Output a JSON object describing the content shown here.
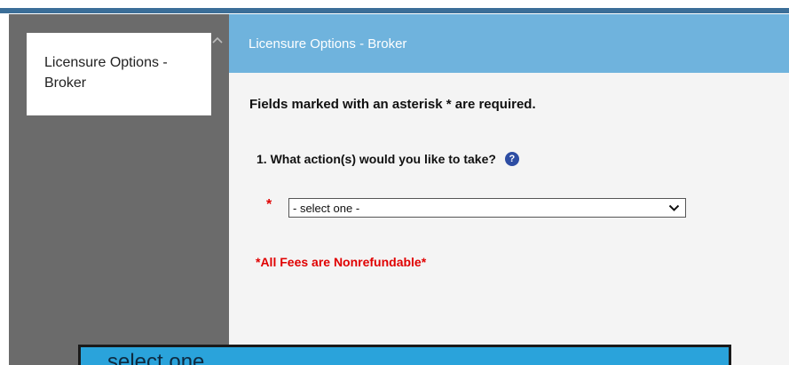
{
  "sidebar": {
    "items": [
      {
        "label": "Licensure Options - Broker"
      }
    ]
  },
  "header": {
    "title": "Licensure Options - Broker"
  },
  "form": {
    "required_note": "Fields marked with an asterisk * are required.",
    "question": "1. What action(s) would you like to take?",
    "help_glyph": "?",
    "asterisk": "*",
    "select": {
      "value": "- select one -",
      "options": [
        "select one"
      ]
    },
    "fees_note": "*All Fees are Nonrefundable*"
  },
  "colors": {
    "header_bg": "#6fb3dd",
    "sidebar_bg": "#6b6b6b",
    "required_red": "#e00000",
    "popup_highlight": "#2aa3db"
  }
}
